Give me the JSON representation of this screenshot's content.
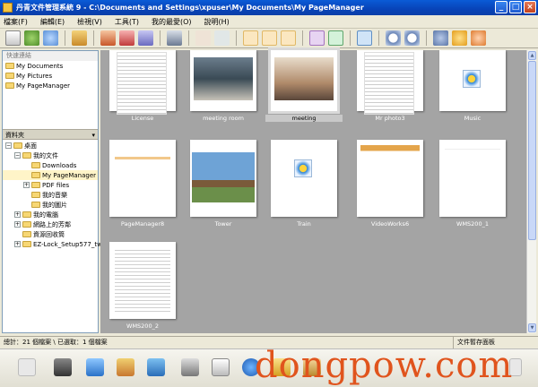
{
  "window": {
    "title": "丹青文件管理系統 9    - C:\\Documents and Settings\\xpuser\\My Documents\\My PageManager"
  },
  "menu": [
    "檔案(F)",
    "編輯(E)",
    "檢視(V)",
    "工具(T)",
    "我的最愛(O)",
    "說明(H)"
  ],
  "quick": {
    "heading": "快速連結",
    "items": [
      "My Documents",
      "My Pictures",
      "My PageManager"
    ]
  },
  "folders": {
    "heading": "資料夾",
    "items": [
      {
        "label": "桌面",
        "indent": 0,
        "pm": "−"
      },
      {
        "label": "我的文件",
        "indent": 1,
        "pm": "−"
      },
      {
        "label": "Downloads",
        "indent": 2,
        "pm": ""
      },
      {
        "label": "My PageManager",
        "indent": 2,
        "pm": "",
        "selected": true
      },
      {
        "label": "PDF files",
        "indent": 2,
        "pm": "+"
      },
      {
        "label": "我的音樂",
        "indent": 2,
        "pm": ""
      },
      {
        "label": "我的圖片",
        "indent": 2,
        "pm": ""
      },
      {
        "label": "我的電腦",
        "indent": 1,
        "pm": "+"
      },
      {
        "label": "網路上的芳鄰",
        "indent": 1,
        "pm": "+"
      },
      {
        "label": "資源回收筒",
        "indent": 1,
        "pm": ""
      },
      {
        "label": "EZ-Lock_Setup577_tw",
        "indent": 1,
        "pm": "+"
      }
    ]
  },
  "thumbnails": [
    {
      "caption": "License",
      "kind": "doc"
    },
    {
      "caption": "meeting room",
      "kind": "photo"
    },
    {
      "caption": "meeting",
      "kind": "photo2",
      "selected": true
    },
    {
      "caption": "Mr photo3",
      "kind": "doc"
    },
    {
      "caption": "Music",
      "kind": "media"
    },
    {
      "caption": "PageManager8",
      "kind": "doc2"
    },
    {
      "caption": "Tower",
      "kind": "tower"
    },
    {
      "caption": "Train",
      "kind": "media"
    },
    {
      "caption": "VideoWorks6",
      "kind": "web"
    },
    {
      "caption": "WMS200_1",
      "kind": "product"
    },
    {
      "caption": "WMS200_2",
      "kind": "doc3"
    }
  ],
  "status": {
    "left": "總計：21 個檔案 \\ 已選取：1 個檔案",
    "right": "文件暫存面板"
  },
  "watermark": "dongpow.com"
}
